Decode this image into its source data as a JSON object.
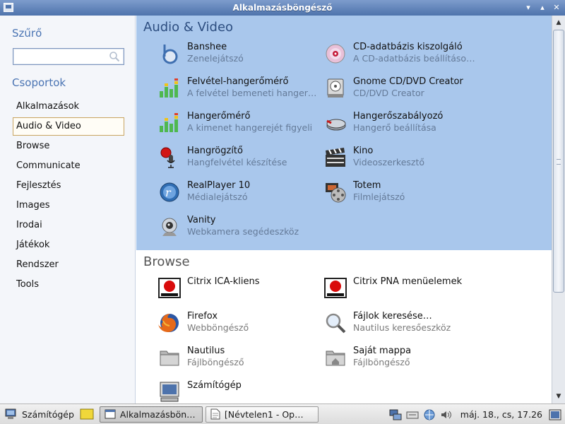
{
  "window": {
    "title": "Alkalmazásböngésző",
    "controls": [
      "▾",
      "▴",
      "✕"
    ]
  },
  "sidebar": {
    "filter_title": "Szűrő",
    "search_value": "",
    "groups_title": "Csoportok",
    "groups": [
      {
        "label": "Alkalmazások",
        "active": false
      },
      {
        "label": "Audio & Video",
        "active": true
      },
      {
        "label": "Browse",
        "active": false
      },
      {
        "label": "Communicate",
        "active": false
      },
      {
        "label": "Fejlesztés",
        "active": false
      },
      {
        "label": "Images",
        "active": false
      },
      {
        "label": "Irodai",
        "active": false
      },
      {
        "label": "Játékok",
        "active": false
      },
      {
        "label": "Rendszer",
        "active": false
      },
      {
        "label": "Tools",
        "active": false
      }
    ]
  },
  "sections": [
    {
      "title": "Audio & Video",
      "selected": true,
      "apps": [
        {
          "name": "Banshee",
          "desc": "Zenelejátszó",
          "icon": "banshee-icon"
        },
        {
          "name": "CD-adatbázis kiszolgáló",
          "desc": "A CD-adatbázis beállításo…",
          "icon": "cd-icon"
        },
        {
          "name": "Felvétel-hangerőmérő",
          "desc": "A felvétel bemeneti hanger…",
          "icon": "level-meter-icon"
        },
        {
          "name": "Gnome CD/DVD Creator",
          "desc": "CD/DVD Creator",
          "icon": "cd-burner-icon"
        },
        {
          "name": "Hangerőmérő",
          "desc": "A kimenet hangerejét figyeli",
          "icon": "level-meter-icon"
        },
        {
          "name": "Hangerőszabályozó",
          "desc": "Hangerő beállítása",
          "icon": "volume-control-icon"
        },
        {
          "name": "Hangrögzítő",
          "desc": "Hangfelvétel készítése",
          "icon": "microphone-icon"
        },
        {
          "name": "Kino",
          "desc": "Videoszerkesztő",
          "icon": "clapper-icon"
        },
        {
          "name": "RealPlayer 10",
          "desc": "Médialejátszó",
          "icon": "realplayer-icon"
        },
        {
          "name": "Totem",
          "desc": "Filmlejátszó",
          "icon": "film-reel-icon"
        },
        {
          "name": "Vanity",
          "desc": "Webkamera segédeszköz",
          "icon": "webcam-icon"
        }
      ]
    },
    {
      "title": "Browse",
      "selected": false,
      "apps": [
        {
          "name": "Citrix ICA-kliens",
          "desc": "",
          "icon": "citrix-icon"
        },
        {
          "name": "Citrix PNA menüelemek",
          "desc": "",
          "icon": "citrix-icon"
        },
        {
          "name": "Firefox",
          "desc": "Webböngésző",
          "icon": "firefox-icon"
        },
        {
          "name": "Fájlok keresése…",
          "desc": "Nautilus keresőeszköz",
          "icon": "magnifier-icon"
        },
        {
          "name": "Nautilus",
          "desc": "Fájlböngésző",
          "icon": "folder-icon"
        },
        {
          "name": "Saját mappa",
          "desc": "Fájlböngésző",
          "icon": "home-folder-icon"
        },
        {
          "name": "Számítógép",
          "desc": "",
          "icon": "computer-icon"
        }
      ]
    }
  ],
  "taskbar": {
    "start_label": "Számítógép",
    "tasks": [
      {
        "label": "Alkalmazásbön…",
        "active": true,
        "icon": "window-icon"
      },
      {
        "label": "[Névtelen1 - Op…",
        "active": false,
        "icon": "document-icon"
      }
    ],
    "clock": "máj. 18., cs, 17.26"
  },
  "colors": {
    "accent": "#4a74b3",
    "selection": "#a9c7ec",
    "titlebar": "#4e73ac"
  }
}
